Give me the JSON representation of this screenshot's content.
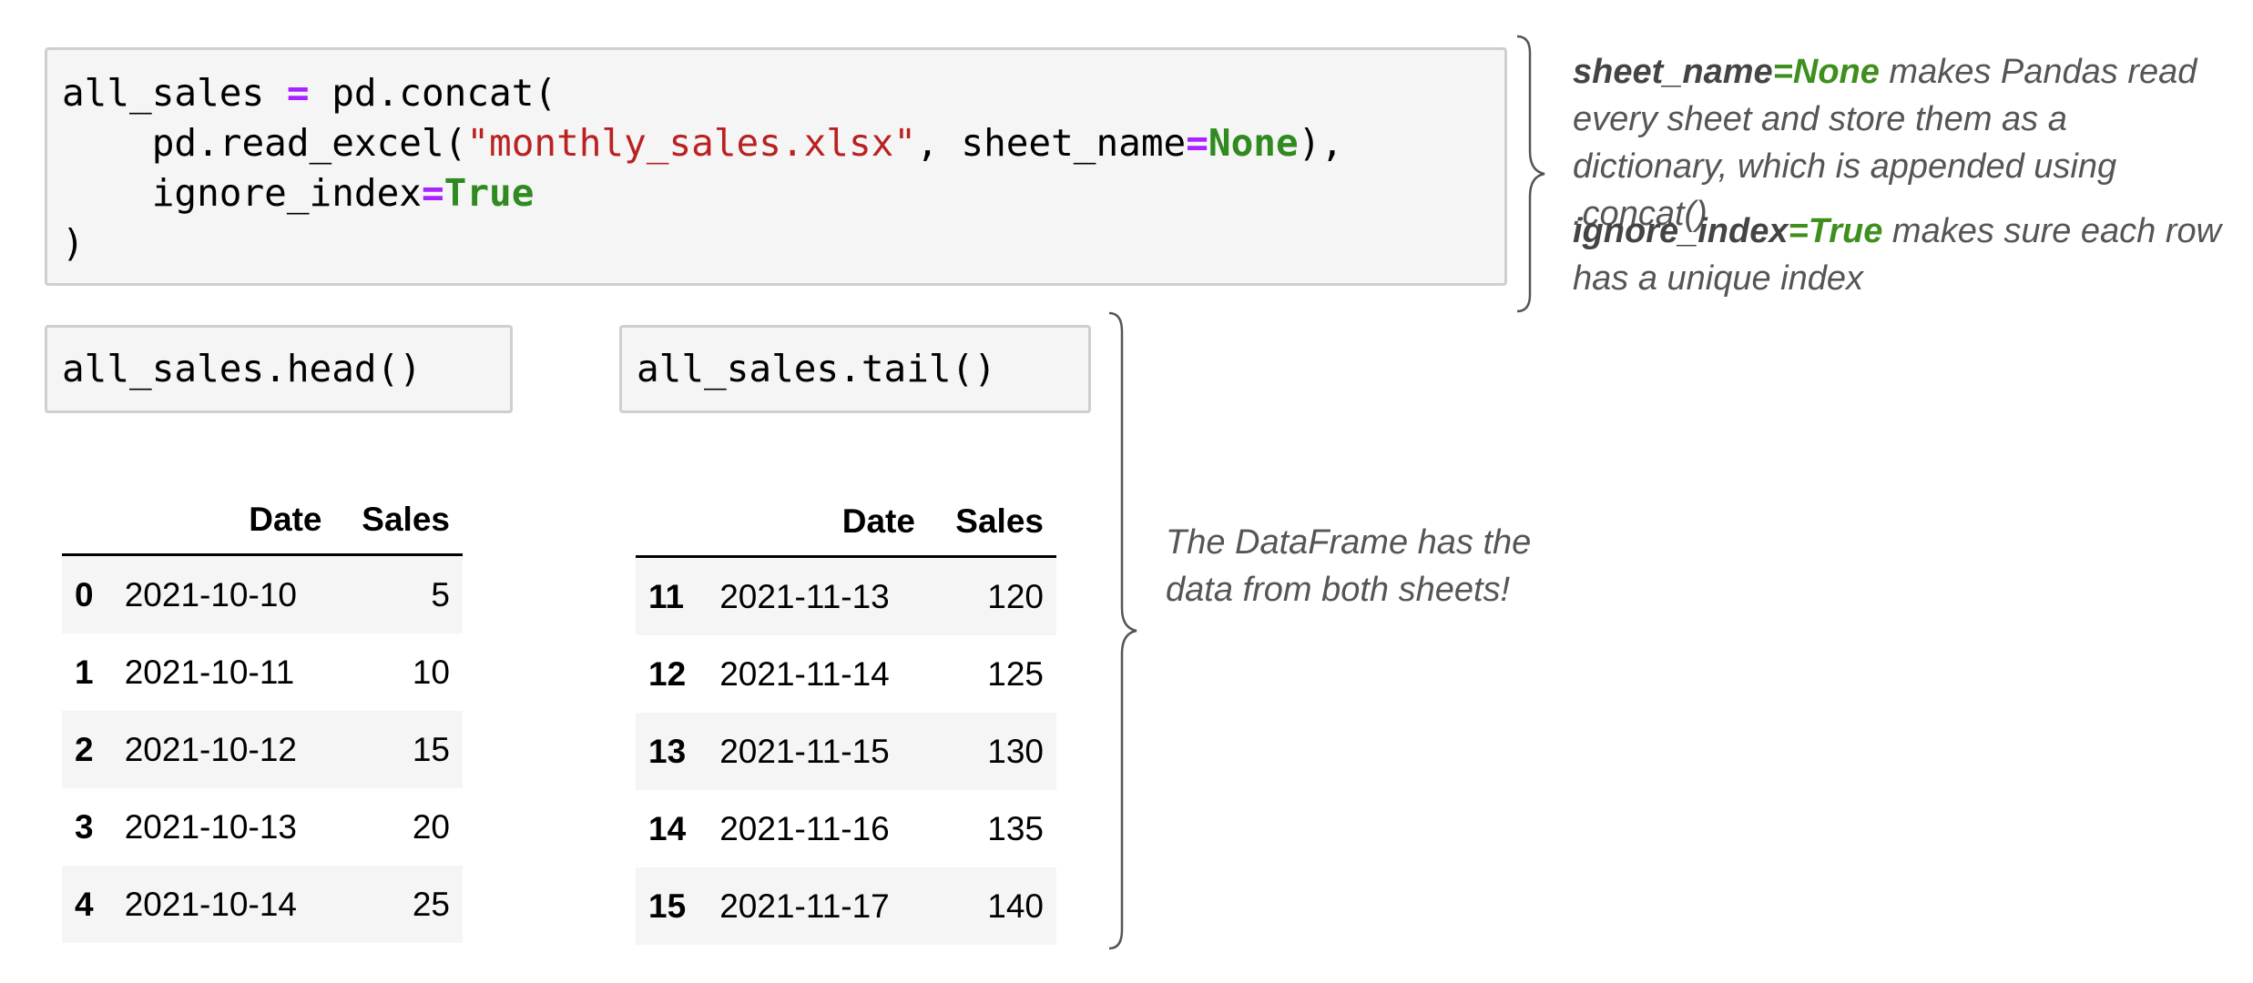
{
  "code": {
    "line1": {
      "var": "all_sales",
      "op": "=",
      "call": "pd.concat("
    },
    "line2": {
      "call": "pd.read_excel(",
      "str": "\"monthly_sales.xlsx\"",
      "sep": ", sheet_name",
      "op": "=",
      "kw": "None",
      "end": "),"
    },
    "line3": {
      "arg": "ignore_index",
      "op": "=",
      "kw": "True"
    },
    "line4": {
      "text": ")"
    }
  },
  "head_cell": "all_sales.head()",
  "tail_cell": "all_sales.tail()",
  "head_table": {
    "columns": [
      "Date",
      "Sales"
    ],
    "rows": [
      {
        "index": "0",
        "date": "2021-10-10",
        "sales": "5"
      },
      {
        "index": "1",
        "date": "2021-10-11",
        "sales": "10"
      },
      {
        "index": "2",
        "date": "2021-10-12",
        "sales": "15"
      },
      {
        "index": "3",
        "date": "2021-10-13",
        "sales": "20"
      },
      {
        "index": "4",
        "date": "2021-10-14",
        "sales": "25"
      }
    ]
  },
  "tail_table": {
    "columns": [
      "Date",
      "Sales"
    ],
    "rows": [
      {
        "index": "11",
        "date": "2021-11-13",
        "sales": "120"
      },
      {
        "index": "12",
        "date": "2021-11-14",
        "sales": "125"
      },
      {
        "index": "13",
        "date": "2021-11-15",
        "sales": "130"
      },
      {
        "index": "14",
        "date": "2021-11-16",
        "sales": "135"
      },
      {
        "index": "15",
        "date": "2021-11-17",
        "sales": "140"
      }
    ]
  },
  "notes": {
    "note1": {
      "name": "sheet_name",
      "op": "=",
      "val": "None",
      "rest": " makes Pandas read every sheet and store them as a dictionary, which is appended using .concat()"
    },
    "note2": {
      "name": "ignore_index",
      "op": "=",
      "val": "True",
      "rest": " makes sure each row has a unique index"
    },
    "note3": {
      "text": "The DataFrame has the data from both sheets!"
    }
  },
  "colors": {
    "keyword": "#2f8a1f",
    "operator": "#aa22ff",
    "string": "#ba2121",
    "cell_bg": "#f5f5f5"
  }
}
